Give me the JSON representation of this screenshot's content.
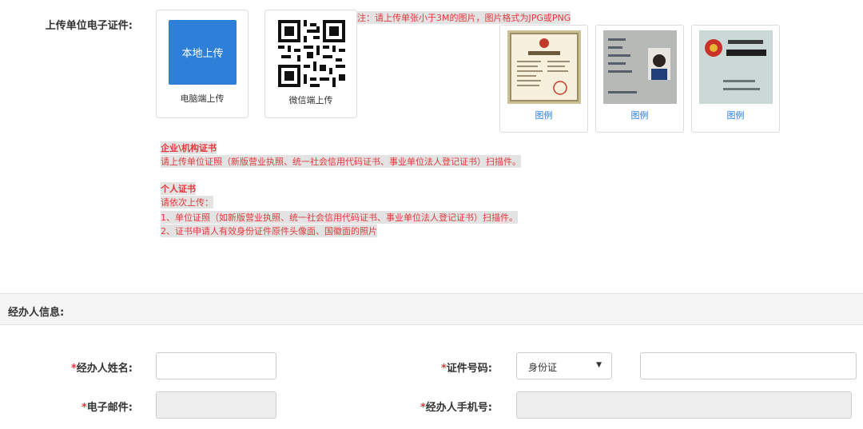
{
  "upload": {
    "label": "上传单位电子证件:",
    "local_button": "本地上传",
    "local_caption": "电脑端上传",
    "wechat_caption": "微信端上传",
    "note": "注：请上传单张小于3M的图片，图片格式为JPG或PNG",
    "samples": [
      {
        "caption": "图例",
        "icon": "business-license-image"
      },
      {
        "caption": "图例",
        "icon": "id-card-front-image"
      },
      {
        "caption": "图例",
        "icon": "id-card-back-image"
      }
    ]
  },
  "requirements": {
    "enterprise_title": "企业\\机构证书",
    "enterprise_text": "请上传单位证照（新版营业执照、统一社会信用代码证书、事业单位法人登记证书）扫描件。",
    "personal_title": "个人证书",
    "personal_lines": [
      "请依次上传：",
      "1、单位证照（如新版营业执照、统一社会信用代码证书、事业单位法人登记证书）扫描件。",
      "2、证书申请人有效身份证件原件头像面、国徽面的照片"
    ]
  },
  "operator": {
    "section_title": "经办人信息:",
    "required_mark": "*",
    "name_label": "经办人姓名:",
    "name_value": "",
    "email_label": "电子邮件:",
    "email_value": "",
    "id_label": "证件号码:",
    "id_type_selected": "身份证",
    "id_value": "",
    "phone_label": "经办人手机号:",
    "phone_value": ""
  },
  "colors": {
    "accent": "#2d7fd8",
    "required": "#e4393c"
  }
}
